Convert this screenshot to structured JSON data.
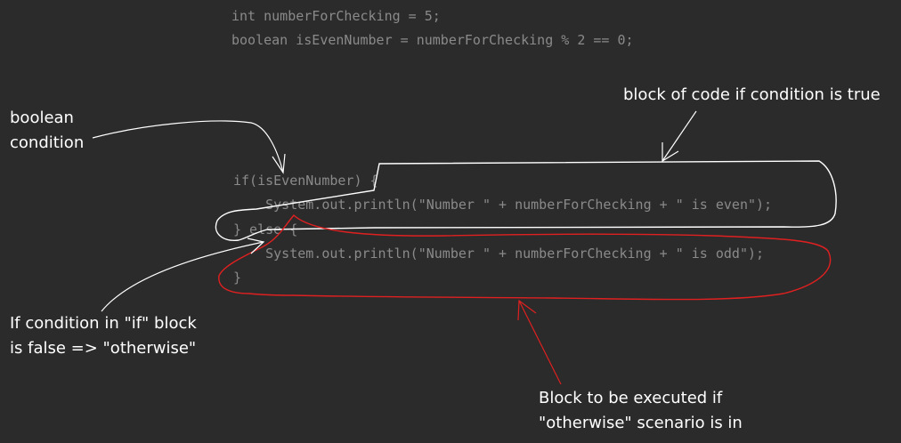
{
  "code": {
    "line1": "int numberForChecking = 5;",
    "line2": "boolean isEvenNumber = numberForChecking % 2 == 0;",
    "line3": "if(isEvenNumber) {",
    "line4": "    System.out.println(\"Number \" + numberForChecking + \" is even\");",
    "line5": "} else {",
    "line6": "    System.out.println(\"Number \" + numberForChecking + \" is odd\");",
    "line7": "}"
  },
  "annotations": {
    "boolean_condition": "boolean\ncondition",
    "true_block": "block of code if condition is true",
    "else_note": "If condition in \"if\" block\nis false => \"otherwise\"",
    "otherwise_block": "Block to be executed if\n\"otherwise\" scenario is in"
  },
  "colors": {
    "background": "#2b2b2b",
    "code_text": "#8a8a8a",
    "annotation_text": "#ffffff",
    "true_outline": "#ffffff",
    "else_outline": "#e02020"
  }
}
